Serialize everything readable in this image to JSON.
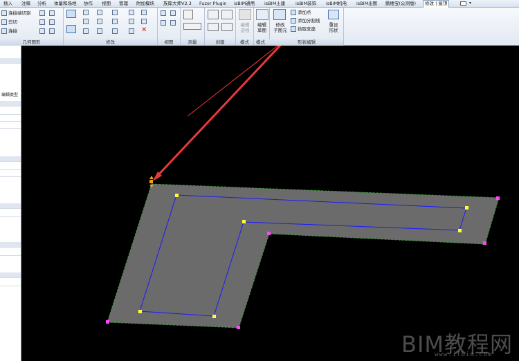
{
  "tabs": [
    {
      "label": "插入"
    },
    {
      "label": "注释"
    },
    {
      "label": "分析"
    },
    {
      "label": "体量和场地"
    },
    {
      "label": "协作"
    },
    {
      "label": "视图"
    },
    {
      "label": "管理"
    },
    {
      "label": "附加模块"
    },
    {
      "label": "族库大师V2.3"
    },
    {
      "label": "Fuzor Plugin"
    },
    {
      "label": "isBIM通用"
    },
    {
      "label": "isBIM土建"
    },
    {
      "label": "isBIM装饰"
    },
    {
      "label": "isBIM机电"
    },
    {
      "label": "isBIM出图"
    },
    {
      "label": "鹏楼宝(公测版)"
    },
    {
      "label": "修改 | 屋顶"
    }
  ],
  "ribbon": {
    "geometry": {
      "label": "几何图形",
      "join_cut": "连接端切割",
      "cut": "剪切",
      "join": "连接"
    },
    "modify": {
      "label": "修改"
    },
    "view": {
      "label": "视图"
    },
    "measure": {
      "label": "测量"
    },
    "create": {
      "label": "创建"
    },
    "mode": {
      "label": "模式",
      "edit_footprint": "编辑\n迹线"
    },
    "mode2": {
      "label": "模式",
      "edit_sketch": "编辑\n草图"
    },
    "shape_edit": {
      "label": "形状编辑",
      "modify_subelements": "修改\n子图元",
      "add_point": "添加点",
      "add_split_line": "添加分割线",
      "pick_supports": "拾取支座",
      "reset_shape": "重设\n形状"
    }
  },
  "properties": {
    "type_edit": "编辑类型"
  },
  "watermark": {
    "text": "BIM教程网",
    "url": "www.ifbim.com"
  },
  "colors": {
    "roof_fill": "#6b6b6b",
    "sketch_line": "#1a1aff",
    "edge_line": "#3a9a3a",
    "arrow": "#e83a3a",
    "vertex_yellow": "#ffff33",
    "vertex_magenta": "#ff44ff"
  }
}
